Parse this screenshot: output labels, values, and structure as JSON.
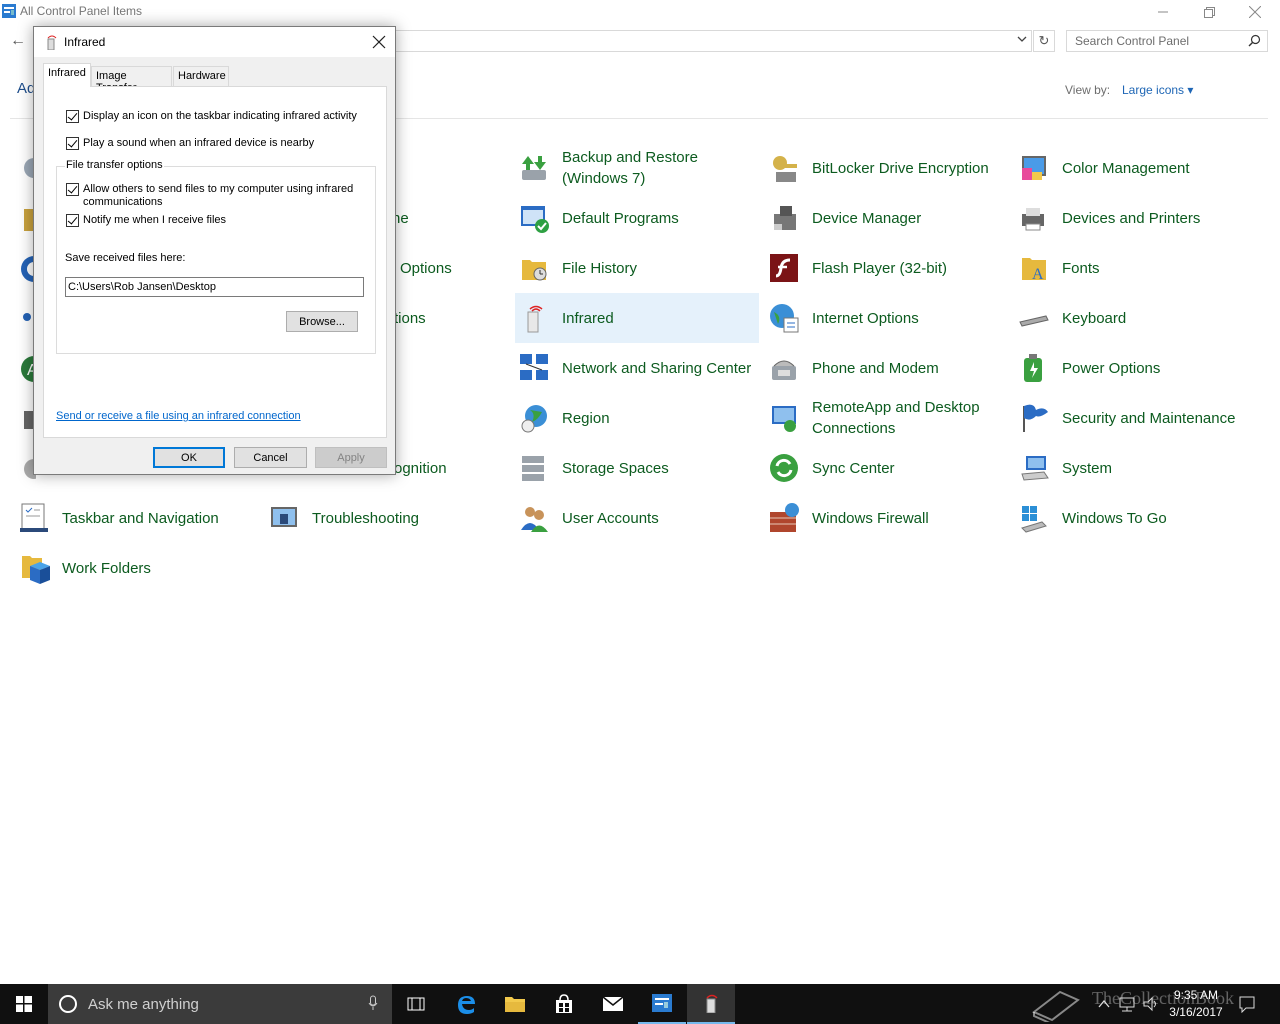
{
  "window": {
    "title": "All Control Panel Items",
    "search_placeholder": "Search Control Panel",
    "adjust_label": "Ad",
    "view_by_label": "View by:",
    "view_by_value": "Large icons ▾"
  },
  "items": {
    "backup": "Backup and Restore (Windows 7)",
    "bitlocker": "BitLocker Drive Encryption",
    "color_mgmt": "Color Management",
    "partial_row2": "ne",
    "default_programs": "Default Programs",
    "device_manager": "Device Manager",
    "devices_printers": "Devices and Printers",
    "partial_row3": "Options",
    "file_history": "File History",
    "flash_player": "Flash Player (32-bit)",
    "fonts": "Fonts",
    "partial_row4": "tions",
    "infrared": "Infrared",
    "internet_options": "Internet Options",
    "keyboard": "Keyboard",
    "network": "Network and Sharing Center",
    "phone_modem": "Phone and Modem",
    "power_options": "Power Options",
    "region": "Region",
    "remoteapp": "RemoteApp and Desktop Connections",
    "security": "Security and Maintenance",
    "partial_row7": "ognition",
    "storage_spaces": "Storage Spaces",
    "sync_center": "Sync Center",
    "system": "System",
    "taskbar_nav": "Taskbar and Navigation",
    "troubleshooting": "Troubleshooting",
    "user_accounts": "User Accounts",
    "windows_firewall": "Windows Firewall",
    "windows_to_go": "Windows To Go",
    "work_folders": "Work Folders"
  },
  "dialog": {
    "title": "Infrared",
    "tabs": [
      "Infrared",
      "Image Transfer",
      "Hardware"
    ],
    "chk_taskbar_icon": "Display an icon on the taskbar indicating infrared activity",
    "chk_play_sound": "Play a sound when an infrared device is nearby",
    "group_label": "File transfer options",
    "chk_allow_others_1": "Allow others to send files to my computer using infrared",
    "chk_allow_others_2": "communications",
    "chk_notify": "Notify me when I receive files",
    "save_label": "Save received files here:",
    "save_path": "C:\\Users\\Rob Jansen\\Desktop",
    "browse": "Browse...",
    "link": "Send or receive a file using an infrared connection",
    "ok": "OK",
    "cancel": "Cancel",
    "apply": "Apply"
  },
  "taskbar": {
    "search_text": "Ask me anything",
    "time": "9:35 AM",
    "date": "3/16/2017",
    "watermark": "TheCollectionBook"
  },
  "colors": {
    "item_text": "#0c5b1f",
    "selected_bg": "#e5f1fb",
    "taskbar_bg": "#101010",
    "link": "#0066cc"
  }
}
